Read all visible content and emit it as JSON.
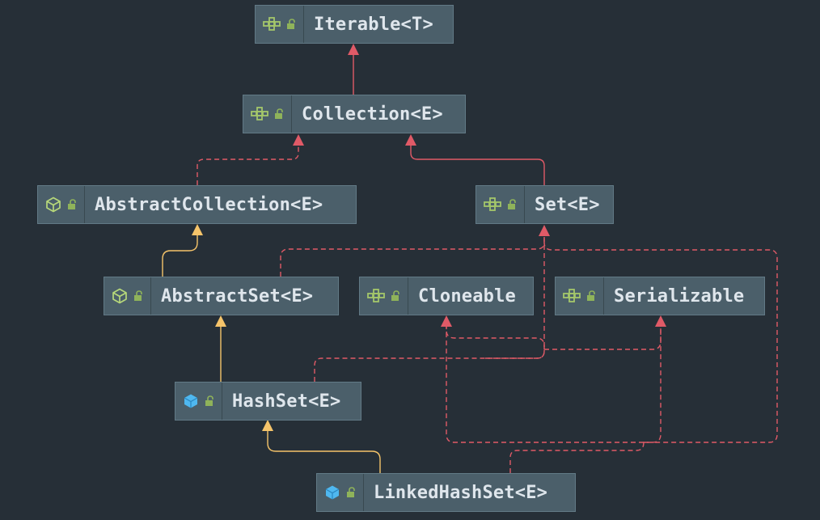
{
  "diagram": {
    "nodes": {
      "iterable": {
        "label": "Iterable<T>",
        "kind": "interface"
      },
      "collection": {
        "label": "Collection<E>",
        "kind": "interface"
      },
      "abstract_collection": {
        "label": "AbstractCollection<E>",
        "kind": "abstract-class"
      },
      "set": {
        "label": "Set<E>",
        "kind": "interface"
      },
      "abstract_set": {
        "label": "AbstractSet<E>",
        "kind": "abstract-class"
      },
      "cloneable": {
        "label": "Cloneable",
        "kind": "interface"
      },
      "serializable": {
        "label": "Serializable",
        "kind": "interface"
      },
      "hash_set": {
        "label": "HashSet<E>",
        "kind": "class"
      },
      "linked_hash_set": {
        "label": "LinkedHashSet<E>",
        "kind": "class"
      }
    },
    "edges": [
      {
        "from": "collection",
        "to": "iterable",
        "type": "extends"
      },
      {
        "from": "abstract_collection",
        "to": "collection",
        "type": "implements"
      },
      {
        "from": "set",
        "to": "collection",
        "type": "extends"
      },
      {
        "from": "abstract_set",
        "to": "abstract_collection",
        "type": "class-extends"
      },
      {
        "from": "abstract_set",
        "to": "set",
        "type": "implements"
      },
      {
        "from": "hash_set",
        "to": "abstract_set",
        "type": "class-extends"
      },
      {
        "from": "hash_set",
        "to": "set",
        "type": "implements"
      },
      {
        "from": "hash_set",
        "to": "cloneable",
        "type": "implements"
      },
      {
        "from": "hash_set",
        "to": "serializable",
        "type": "implements"
      },
      {
        "from": "linked_hash_set",
        "to": "hash_set",
        "type": "class-extends"
      },
      {
        "from": "linked_hash_set",
        "to": "set",
        "type": "implements"
      },
      {
        "from": "linked_hash_set",
        "to": "cloneable",
        "type": "implements"
      },
      {
        "from": "linked_hash_set",
        "to": "serializable",
        "type": "implements"
      }
    ],
    "colors": {
      "background": "#262f37",
      "node_fill": "#4b5f6a",
      "interface_edge": "#e05a67",
      "class_edge": "#f5c46a",
      "interface_icon": "#a4c66a",
      "class_icon": "#4fb8f0",
      "abstract_icon": "#b7d87a"
    }
  }
}
